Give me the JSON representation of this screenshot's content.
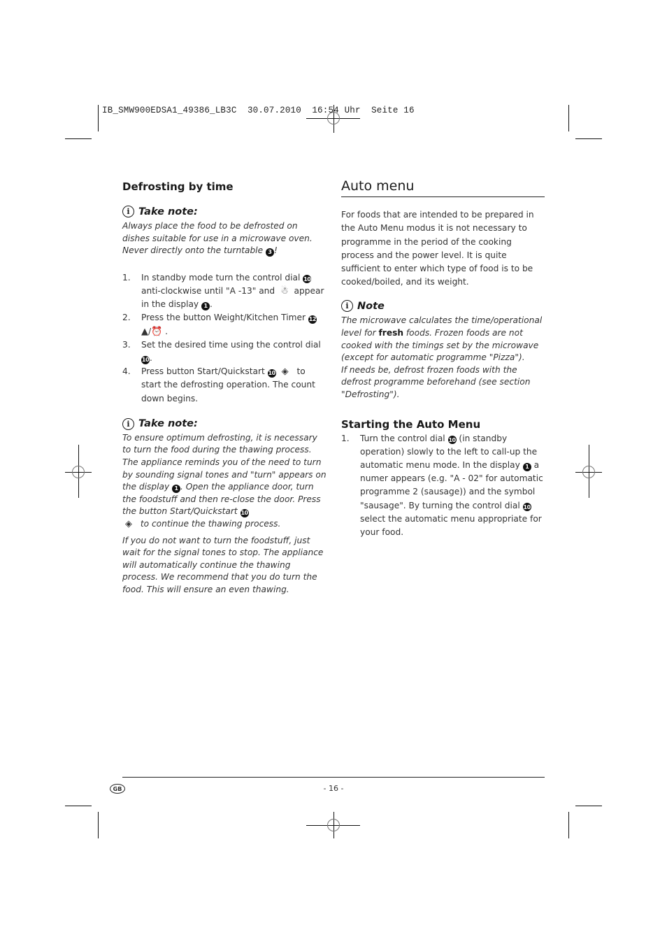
{
  "slug": {
    "file": "IB_SMW900EDSA1_49386_LB3C",
    "date": "30.07.2010",
    "time": "16:54 Uhr",
    "page": "Seite 16"
  },
  "left": {
    "heading": "Defrosting by time",
    "note1": {
      "title": "Take note:",
      "text_a": "Always place the food to be defrosted on dishes suitable for use in a microwave oven. Never directly onto the turntable ",
      "ref": "3",
      "text_b": "!"
    },
    "steps": [
      {
        "num": "1.",
        "a": "In standby mode turn the control dial ",
        "ref1": "10",
        "b": " anti-clockwise until \"A -13\" and ",
        "icon": "defrost-symbol",
        "c": " appear in the display ",
        "ref2": "1",
        "d": "."
      },
      {
        "num": "2.",
        "a": "Press the button Weight/Kitchen Timer ",
        "ref1": "12",
        "icon": "weight-timer-symbol",
        "b": " ."
      },
      {
        "num": "3.",
        "a": "Set the desired time using the control dial ",
        "ref1": "10",
        "b": "."
      },
      {
        "num": "4.",
        "a": "Press button Start/Quickstart ",
        "ref1": "10",
        "icon": "start-symbol",
        "b": " to start the defrosting operation. The count down begins."
      }
    ],
    "note2": {
      "title": "Take note:",
      "text_a": "To ensure optimum defrosting, it is necessary to turn the food during the thawing process. The appliance reminds you of the need to turn by sounding signal tones and \"turn\" appears on the display ",
      "ref1": "1",
      "text_b": ". Open the appliance door, turn the foodstuff and then re-close the door. Press the button Start/Quickstart ",
      "ref2": "10",
      "text_c": " to continue the thawing process.",
      "para2": "If you do not want to turn the foodstuff, just wait for the signal tones to stop. The appliance will automatically continue the thawing process. We recommend that you do turn the food. This will ensure an even thawing."
    }
  },
  "right": {
    "heading": "Auto menu",
    "intro": "For foods that are intended to be prepared in the Auto Menu modus it is not necessary to programme in the period of the cooking process and the power level. It is quite sufficient to enter which type of food is to be cooked/boiled, and its weight.",
    "note": {
      "title": "Note",
      "text_a": "The microwave calculates the time/operational level for ",
      "bold": "fresh",
      "text_b": "  foods. Frozen foods are not cooked with the timings set by the microwave (except for automatic programme \"Pizza\").",
      "text_c": "If needs be, defrost frozen foods with the defrost programme beforehand (see section \"Defrosting\")."
    },
    "subheading": "Starting the Auto Menu",
    "steps": [
      {
        "num": "1.",
        "a": "Turn the control dial ",
        "ref1": "10",
        "b": " (in standby operation) slowly to the left to call-up the automatic menu mode. In the display ",
        "ref2": "1",
        "c": " a numer appears (e.g. \"A - 02\" for automatic programme 2 (sausage)) and the symbol \"sausage\". By turning the control dial ",
        "ref3": "10",
        "d": " select the  automatic menu appropriate for your food."
      }
    ]
  },
  "footer": {
    "country": "GB",
    "page_number": "- 16 -"
  }
}
